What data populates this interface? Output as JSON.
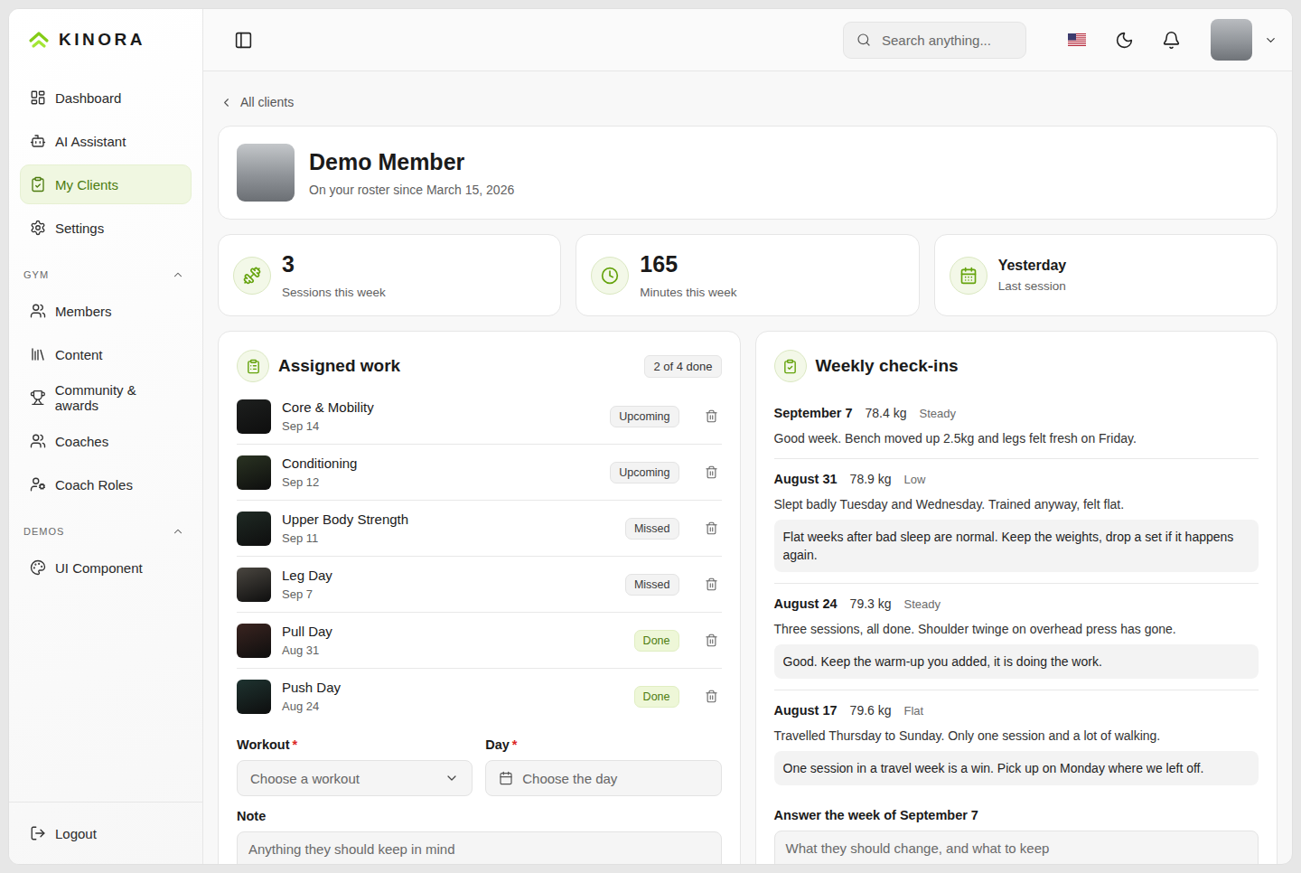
{
  "brand": {
    "name": "KINORA"
  },
  "sidebar": {
    "items": [
      {
        "label": "Dashboard",
        "selected": false
      },
      {
        "label": "AI Assistant",
        "selected": false
      },
      {
        "label": "My Clients",
        "selected": true
      },
      {
        "label": "Settings",
        "selected": false
      }
    ],
    "sections": [
      {
        "title": "GYM",
        "expanded": true,
        "items": [
          {
            "label": "Members",
            "selected": false
          },
          {
            "label": "Content",
            "selected": false
          },
          {
            "label": "Community & awards",
            "selected": false
          },
          {
            "label": "Coaches",
            "selected": false
          },
          {
            "label": "Coach Roles",
            "selected": false
          }
        ]
      },
      {
        "title": "DEMOS",
        "expanded": true,
        "items": [
          {
            "label": "UI Component",
            "selected": false
          }
        ]
      }
    ],
    "logout": "Logout"
  },
  "header": {
    "search_placeholder": "Search anything..."
  },
  "back_link": "All clients",
  "client": {
    "name": "Demo Member",
    "since": "On your roster since March 15, 2026"
  },
  "stats": [
    {
      "value": "3",
      "label": "Sessions this week",
      "kind": "number"
    },
    {
      "value": "165",
      "label": "Minutes this week",
      "kind": "number"
    },
    {
      "value": "Yesterday",
      "label": "Last session",
      "kind": "text"
    }
  ],
  "assigned": {
    "title": "Assigned work",
    "progress": "2 of 4 done",
    "items": [
      {
        "title": "Core & Mobility",
        "date": "Sep 14",
        "status": "Upcoming",
        "kind": "upcoming"
      },
      {
        "title": "Conditioning",
        "date": "Sep 12",
        "status": "Upcoming",
        "kind": "upcoming"
      },
      {
        "title": "Upper Body Strength",
        "date": "Sep 11",
        "status": "Missed",
        "kind": "missed"
      },
      {
        "title": "Leg Day",
        "date": "Sep 7",
        "status": "Missed",
        "kind": "missed"
      },
      {
        "title": "Pull Day",
        "date": "Aug 31",
        "status": "Done",
        "kind": "done"
      },
      {
        "title": "Push Day",
        "date": "Aug 24",
        "status": "Done",
        "kind": "done"
      }
    ],
    "form": {
      "required_mark": "*",
      "fields": [
        {
          "label": "Workout",
          "required": true,
          "placeholder": "Choose a workout",
          "kind": "select"
        },
        {
          "label": "Day",
          "required": true,
          "placeholder": "Choose the day",
          "kind": "date"
        }
      ],
      "note": {
        "label": "Note",
        "placeholder": "Anything they should keep in mind"
      }
    }
  },
  "checkins": {
    "title": "Weekly check-ins",
    "items": [
      {
        "date": "September 7",
        "weight": "78.4 kg",
        "mood": "Steady",
        "text": "Good week. Bench moved up 2.5kg and legs felt fresh on Friday."
      },
      {
        "date": "August 31",
        "weight": "78.9 kg",
        "mood": "Low",
        "text": "Slept badly Tuesday and Wednesday. Trained anyway, felt flat.",
        "reply": "Flat weeks after bad sleep are normal. Keep the weights, drop a set if it happens again."
      },
      {
        "date": "August 24",
        "weight": "79.3 kg",
        "mood": "Steady",
        "text": "Three sessions, all done. Shoulder twinge on overhead press has gone.",
        "reply": "Good. Keep the warm-up you added, it is doing the work."
      },
      {
        "date": "August 17",
        "weight": "79.6 kg",
        "mood": "Flat",
        "text": "Travelled Thursday to Sunday. Only one session and a lot of walking.",
        "reply": "One session in a travel week is a win. Pick up on Monday where we left off."
      }
    ],
    "answer": {
      "label": "Answer the week of September 7",
      "placeholder": "What they should change, and what to keep"
    }
  }
}
